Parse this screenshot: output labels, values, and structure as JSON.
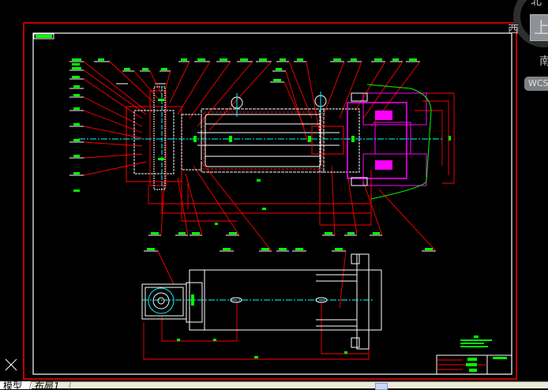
{
  "viewcube": {
    "north": "北",
    "west": "西",
    "top_face": "上",
    "south": "南",
    "wcs": "WCS"
  },
  "tabs": [
    {
      "label": "模型",
      "active": true
    },
    {
      "label": "布局1",
      "active": false
    }
  ],
  "colors": {
    "background": "#000000",
    "border_red": "#ff0000",
    "frame_white": "#ffffff",
    "dimension_green": "#00ff00",
    "centerline_cyan": "#00ffff",
    "part_magenta": "#ff00ff",
    "tabbar": "#ece9d8"
  }
}
